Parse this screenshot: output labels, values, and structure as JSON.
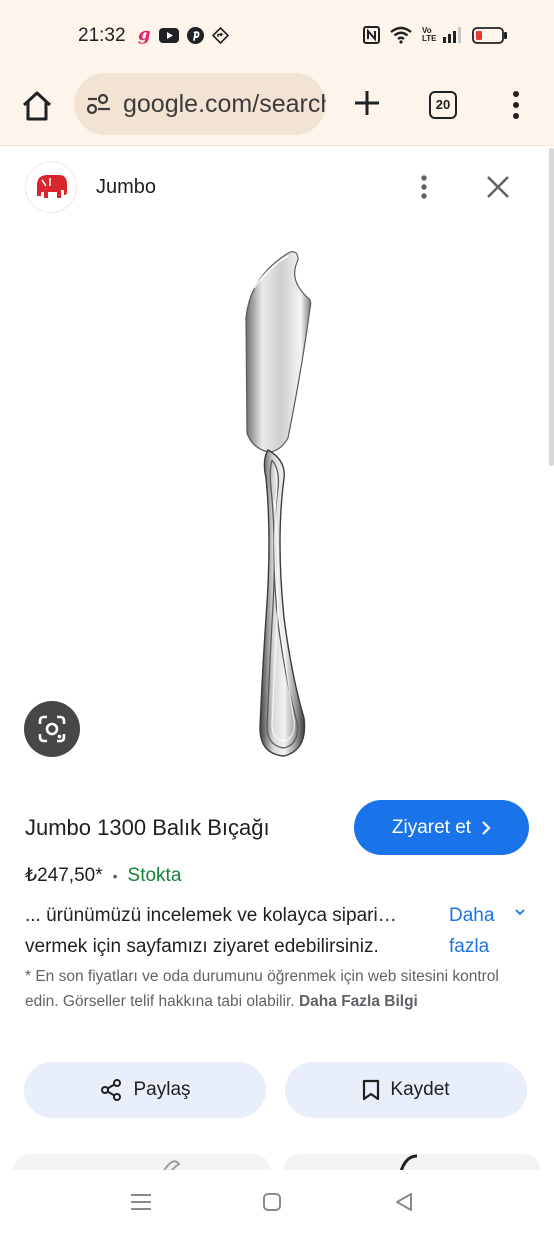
{
  "status_bar": {
    "time": "21:32",
    "left_icons": [
      "gmail-g-icon",
      "youtube-icon",
      "pinterest-icon",
      "navigation-icon"
    ],
    "right_icons": [
      "nfc-icon",
      "wifi-icon",
      "volte-icon",
      "signal-icon",
      "battery-low-icon"
    ],
    "volte_label": "Vo LTE",
    "battery_color": "#e53935"
  },
  "browser": {
    "url": "google.com/search",
    "tab_count": "20"
  },
  "source": {
    "name": "Jumbo",
    "logo_color": "#d7262d"
  },
  "product": {
    "title": "Jumbo 1300 Balık Bıçağı",
    "visit_label": "Ziyaret et",
    "price": "₺247,50*",
    "stock": "Stokta",
    "desc_line1": "... ürünümüzü incelemek ve kolayca sipari…",
    "desc_line2": "vermek için sayfamızı ziyaret edebilirsiniz.",
    "more_label_1": "Daha",
    "more_label_2": "fazla",
    "disclaimer": "* En son fiyatları ve oda durumunu öğrenmek için web sitesini kontrol edin. Görseller telif hakkına tabi olabilir.",
    "disclaimer_link": "Daha Fazla Bilgi"
  },
  "actions": {
    "share_label": "Paylaş",
    "save_label": "Kaydet"
  },
  "colors": {
    "accent_blue": "#1a73e8",
    "stock_green": "#188038",
    "chrome_bg": "#fdf4ec",
    "omnibox_bg": "#f3e3d3",
    "action_bg": "#e8effa"
  }
}
